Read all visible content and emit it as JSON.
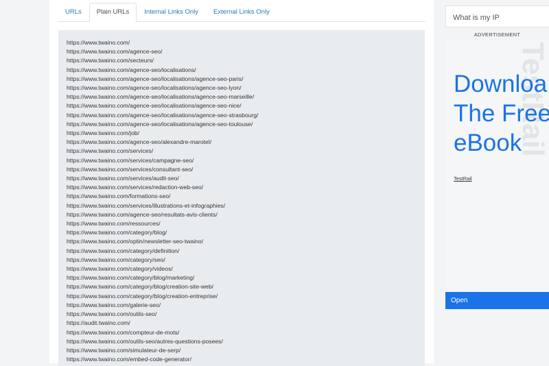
{
  "tabs": [
    {
      "label": "URLs"
    },
    {
      "label": "Plain URLs"
    },
    {
      "label": "Internal Links Only"
    },
    {
      "label": "External Links Only"
    }
  ],
  "active_tab": "Plain URLs",
  "urls": [
    "https://www.twaino.com/",
    "https://www.twaino.com/agence-seo/",
    "https://www.twaino.com/secteurs/",
    "https://www.twaino.com/agence-seo/localisations/",
    "https://www.twaino.com/agence-seo/localisations/agence-seo-paris/",
    "https://www.twaino.com/agence-seo/localisations/agence-seo-lyon/",
    "https://www.twaino.com/agence-seo/localisations/agence-seo-marseille/",
    "https://www.twaino.com/agence-seo/localisations/agence-seo-nice/",
    "https://www.twaino.com/agence-seo/localisations/agence-seo-strasbourg/",
    "https://www.twaino.com/agence-seo/localisations/agence-seo-toulouse/",
    "https://www.twaino.com/job/",
    "https://www.twaino.com/agence-seo/alexandre-marotel/",
    "https://www.twaino.com/services/",
    "https://www.twaino.com/services/campagne-seo/",
    "https://www.twaino.com/services/consultant-seo/",
    "https://www.twaino.com/services/audit-seo/",
    "https://www.twaino.com/services/redaction-web-seo/",
    "https://www.twaino.com/formations-seo/",
    "https://www.twaino.com/services/illustrations-et-infographies/",
    "https://www.twaino.com/agence-seo/resultats-avis-clients/",
    "https://www.twaino.com/ressources/",
    "https://www.twaino.com/category/blog/",
    "https://www.twaino.com/optin/newsletter-seo-twaino/",
    "https://www.twaino.com/category/definition/",
    "https://www.twaino.com/category/seo/",
    "https://www.twaino.com/category/videos/",
    "https://www.twaino.com/category/blog/marketing/",
    "https://www.twaino.com/category/blog/creation-site-web/",
    "https://www.twaino.com/category/blog/creation-entreprise/",
    "https://www.twaino.com/galerie-seo/",
    "https://www.twaino.com/outils-seo/",
    "https://audit.twaino.com/",
    "https://www.twaino.com/compteur-de-mots/",
    "https://www.twaino.com/outils-seo/autres-questions-posees/",
    "https://www.twaino.com/simulateur-de-serp/",
    "https://www.twaino.com/embed-code-generator/"
  ],
  "sidebar": {
    "ip_widget": "What is my IP",
    "ad_label": "ADVERTISEMENT"
  },
  "ad": {
    "background_text": "TestRail",
    "headline": [
      "Downloa",
      "The Free",
      "eBook"
    ],
    "brand": "TestRail",
    "open_label": "Open",
    "accent_color": "#1a73e8"
  }
}
